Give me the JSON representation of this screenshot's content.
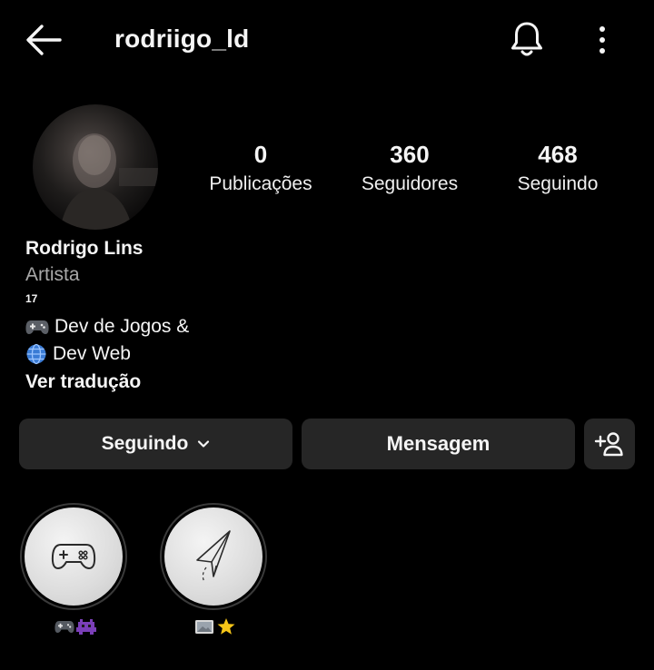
{
  "header": {
    "username": "rodriigo_ld"
  },
  "icons": {
    "back": "arrow-left-icon",
    "bell": "bell-icon",
    "more": "more-vertical-icon",
    "add_user": "add-user-icon",
    "chevron": "chevron-down-icon"
  },
  "stats": {
    "posts": {
      "value": "0",
      "label": "Publicações"
    },
    "followers": {
      "value": "360",
      "label": "Seguidores"
    },
    "following": {
      "value": "468",
      "label": "Seguindo"
    }
  },
  "profile": {
    "name": "Rodrigo Lins",
    "category": "Artista",
    "age": "17",
    "bio_line_1": "Dev de Jogos &",
    "bio_line_2": "Dev Web",
    "translate_link": "Ver tradução"
  },
  "actions": {
    "following_label": "Seguindo",
    "message_label": "Mensagem"
  },
  "highlights": [
    {
      "icon": "gamepad-icon",
      "caption_icons": [
        "gamepad-emoji",
        "alien-monster-emoji"
      ]
    },
    {
      "icon": "paper-plane-icon",
      "caption_icons": [
        "picture-emoji",
        "star-emoji"
      ]
    }
  ],
  "colors": {
    "background": "#000000",
    "button": "#262626",
    "text": "#f5f5f5",
    "muted": "#a8a8a8"
  }
}
